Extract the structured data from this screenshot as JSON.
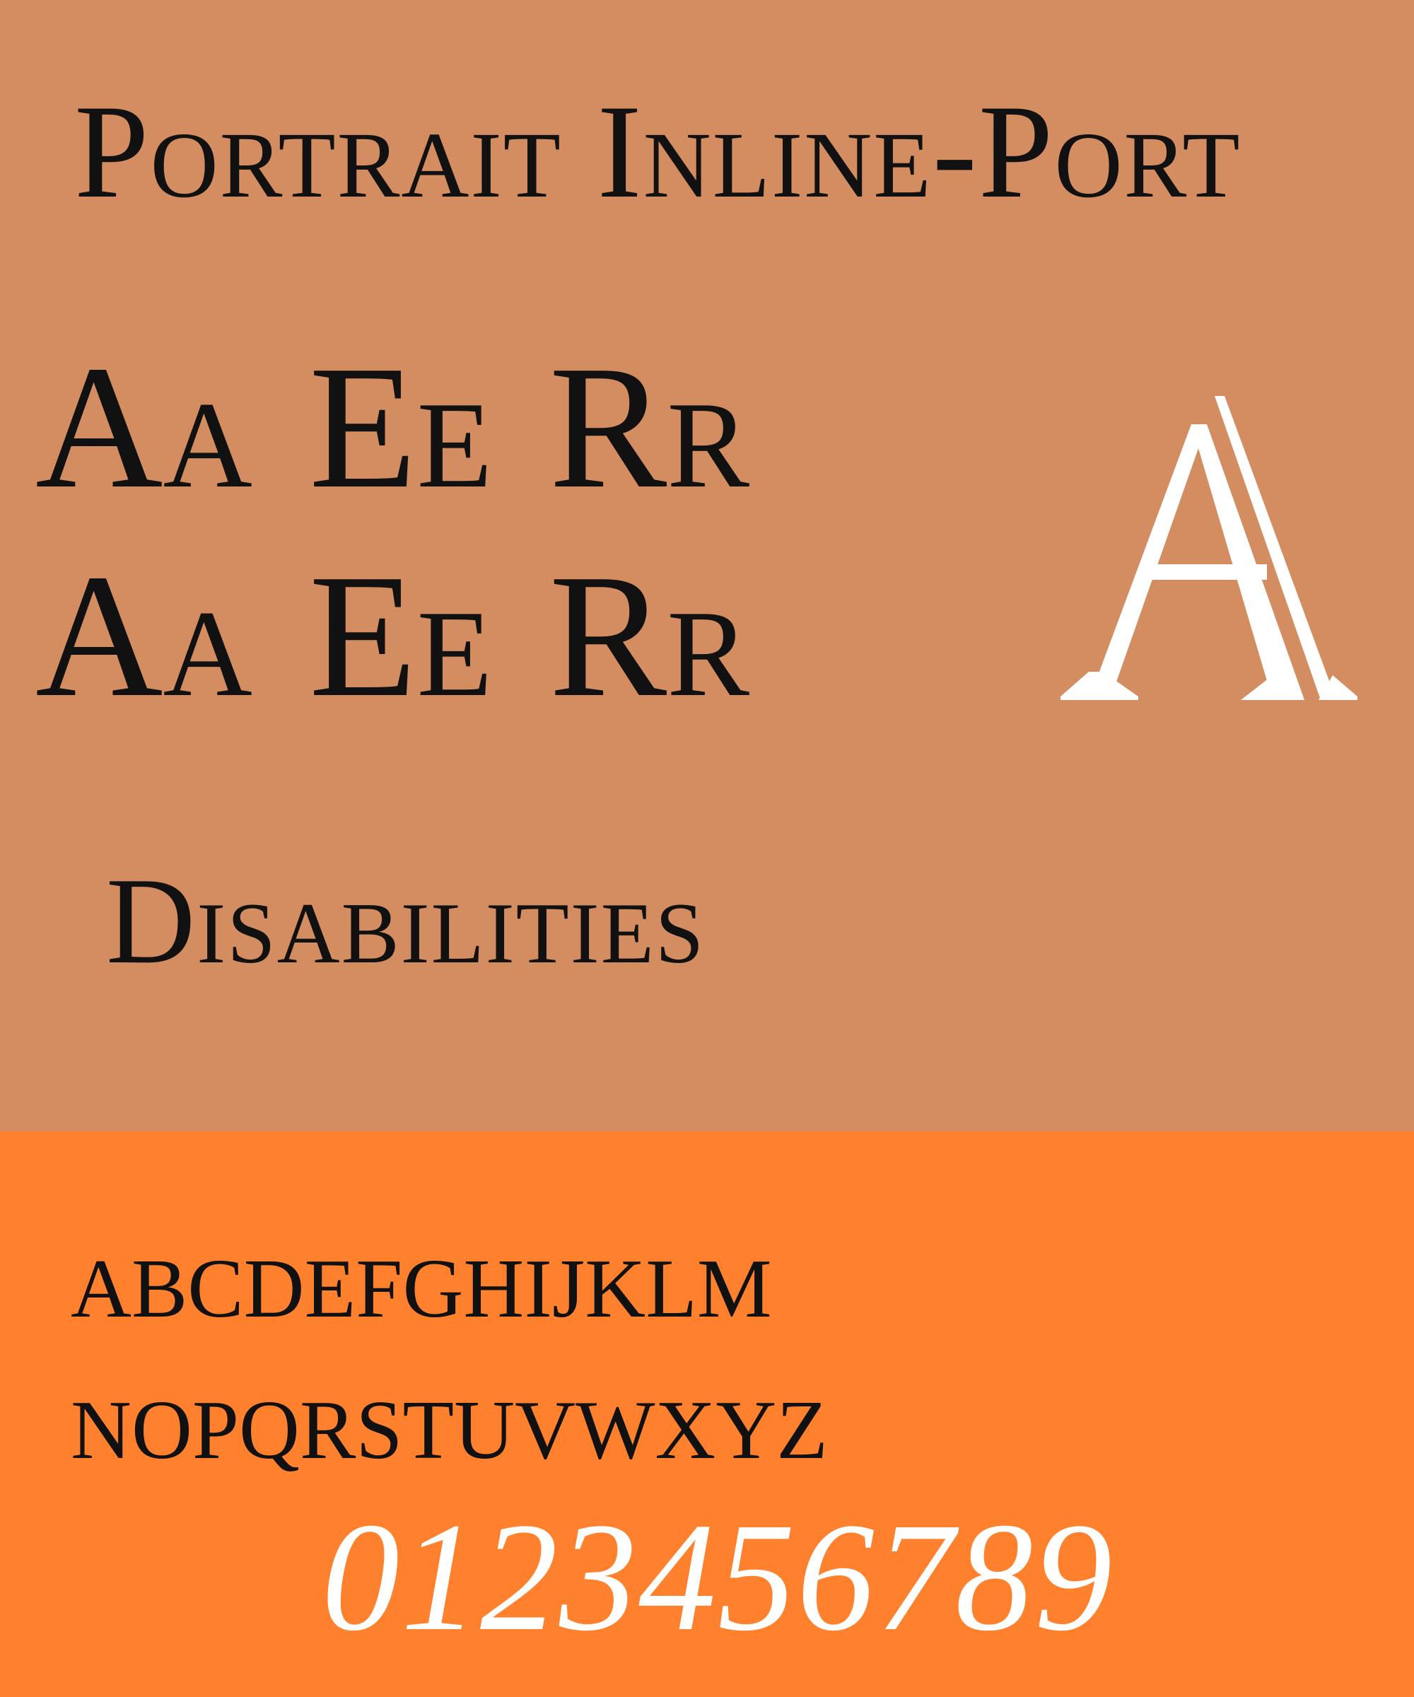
{
  "colors": {
    "top_background": "#D48D60",
    "bottom_background": "#FF812D",
    "dark_text": "#111111",
    "light_text": "#FFFFFF"
  },
  "specimen": {
    "title": "Portrait Inline-Port",
    "pairs_row1": [
      "A",
      "a",
      "E",
      "e",
      "R",
      "r"
    ],
    "pairs_row2": [
      "A",
      "a",
      "E",
      "e",
      "R",
      "r"
    ],
    "big_glyph": "A",
    "sample_word": "Disabilities",
    "alphabet_row1": "abcdefghijklm",
    "alphabet_row2": "nopqrstuvwxyz",
    "digits": "0123456789"
  }
}
